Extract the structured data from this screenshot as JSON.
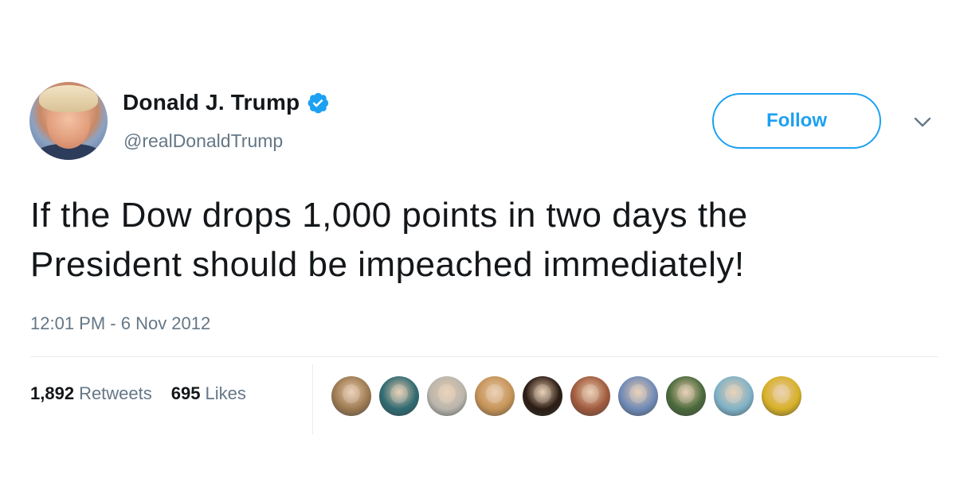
{
  "user": {
    "display_name": "Donald J. Trump",
    "handle": "@realDonaldTrump",
    "verified": true
  },
  "actions": {
    "follow_label": "Follow"
  },
  "tweet": {
    "text_line1": "If the Dow drops 1,000 points in two days the",
    "text_line2": "President should be impeached immediately!",
    "timestamp": "12:01 PM - 6 Nov 2012"
  },
  "stats": {
    "retweets_count": "1,892",
    "retweets_label": "Retweets",
    "likes_count": "695",
    "likes_label": "Likes"
  },
  "likers": [
    {
      "color": "#9c7a52"
    },
    {
      "color": "#2f6b73"
    },
    {
      "color": "#b9b6ae"
    },
    {
      "color": "#c59357"
    },
    {
      "color": "#2a1c14"
    },
    {
      "color": "#a05a3e"
    },
    {
      "color": "#6f8bb8"
    },
    {
      "color": "#4a6a3c"
    },
    {
      "color": "#7fb3c9"
    },
    {
      "color": "#d7b128"
    }
  ],
  "colors": {
    "accent": "#1da1f2",
    "text_primary": "#14171a",
    "text_secondary": "#657786"
  },
  "icons": {
    "verified": "verified-badge-icon",
    "caret": "chevron-down-icon"
  }
}
